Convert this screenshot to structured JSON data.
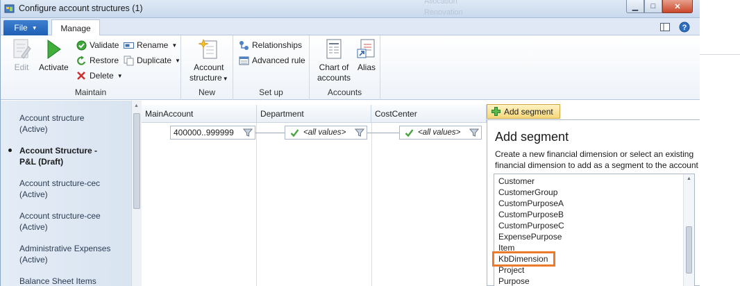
{
  "window": {
    "title": "Configure account structures (1)",
    "ghost_text_1": "Allocation",
    "ghost_text_2": "Renovation",
    "controls": [
      "▁",
      "□",
      "✕"
    ]
  },
  "ribbon": {
    "file_label": "File",
    "manage_tab": "Manage",
    "maintain": {
      "label": "Maintain",
      "edit": "Edit",
      "activate": "Activate",
      "validate": "Validate",
      "restore": "Restore",
      "delete": "Delete",
      "rename": "Rename",
      "duplicate": "Duplicate"
    },
    "new": {
      "label": "New",
      "account_structure_1": "Account",
      "account_structure_2": "structure"
    },
    "setup": {
      "label": "Set up",
      "relationships": "Relationships",
      "advanced_rule": "Advanced rule"
    },
    "accounts": {
      "label": "Accounts",
      "chart_1": "Chart of",
      "chart_2": "accounts",
      "alias": "Alias"
    }
  },
  "nav": {
    "items": [
      {
        "line1": "Account structure",
        "line2": "(Active)"
      },
      {
        "line1": "Account Structure -",
        "line2": "P&L (Draft)"
      },
      {
        "line1": "Account structure-cec",
        "line2": "(Active)"
      },
      {
        "line1": "Account structure-cee",
        "line2": "(Active)"
      },
      {
        "line1": "Administrative Expenses",
        "line2": "(Active)"
      },
      {
        "line1": "Balance Sheet Items",
        "line2": ""
      }
    ]
  },
  "grid": {
    "columns": [
      "MainAccount",
      "Department",
      "CostCenter"
    ],
    "values": [
      "400000..999999",
      "<all values>",
      "<all values>"
    ]
  },
  "add_segment": {
    "button": "Add segment",
    "title": "Add segment",
    "description": "Create a new financial dimension or select an existing financial dimension to add as a segment to the account structure.",
    "options": [
      "Customer",
      "CustomerGroup",
      "CustomPurposeA",
      "CustomPurposeB",
      "CustomPurposeC",
      "ExpensePurpose",
      "Item",
      "KbDimension",
      "Project",
      "Purpose"
    ],
    "highlighted": "KbDimension"
  }
}
